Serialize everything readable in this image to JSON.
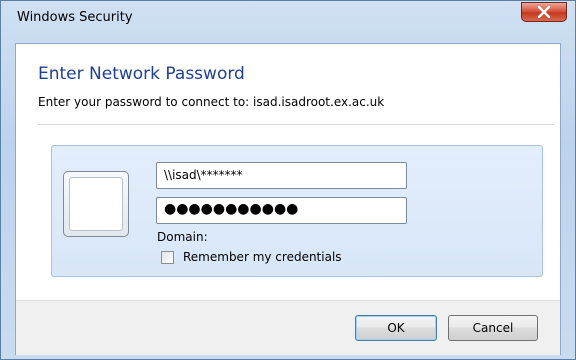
{
  "window": {
    "title": "Windows Security"
  },
  "dialog": {
    "heading": "Enter Network Password",
    "subtitle": "Enter your password to connect to: isad.isadroot.ex.ac.uk"
  },
  "credentials": {
    "username_value": "\\\\isad\\*******",
    "password_value": "●●●●●●●●●●●",
    "domain_label": "Domain:",
    "remember_label": "Remember my credentials",
    "remember_checked": false
  },
  "buttons": {
    "ok_label": "OK",
    "cancel_label": "Cancel"
  },
  "icons": {
    "close": "close-icon",
    "user_tile": "user-tile-icon"
  },
  "colors": {
    "heading": "#1e3f9a",
    "close_button": "#c23a20"
  }
}
